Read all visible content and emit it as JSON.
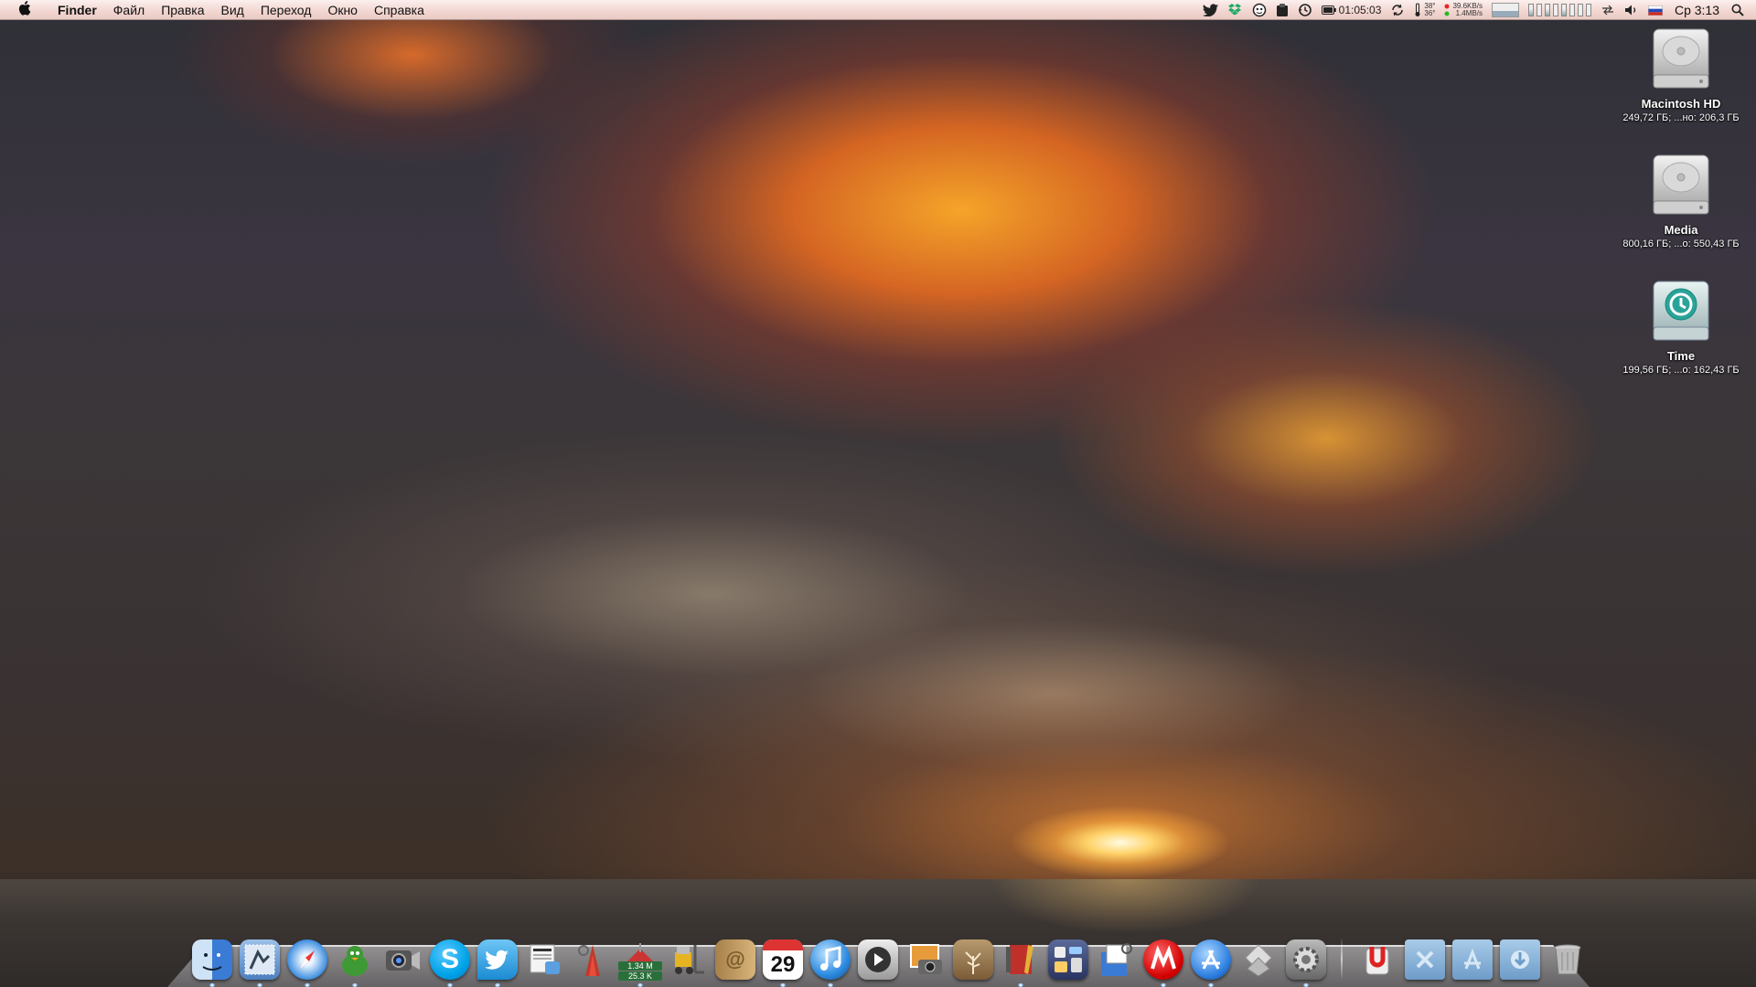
{
  "menubar": {
    "apple_icon": "apple-icon",
    "app_name": "Finder",
    "menus": [
      "Файл",
      "Правка",
      "Вид",
      "Переход",
      "Окно",
      "Справка"
    ],
    "timer": "01:05:03",
    "temp_top": "38°",
    "temp_bottom": "36°",
    "net_down": "39.6KB/s",
    "net_up": "1.4MB/s",
    "clock": "Ср 3:13"
  },
  "desktop": {
    "icons": [
      {
        "name": "Macintosh HD",
        "info": "249,72 ГБ; ...но: 206,3 ГБ",
        "icon": "hard-drive-icon"
      },
      {
        "name": "Media",
        "info": "800,16 ГБ; ...о: 550,43 ГБ",
        "icon": "hard-drive-icon"
      },
      {
        "name": "Time",
        "info": "199,56 ГБ; ...о: 162,43 ГБ",
        "icon": "time-machine-drive-icon"
      }
    ]
  },
  "dock": {
    "calendar_day": "29",
    "transfer_top": "1.34 M",
    "transfer_bottom": "25.3 K",
    "skype_letter": "S"
  }
}
